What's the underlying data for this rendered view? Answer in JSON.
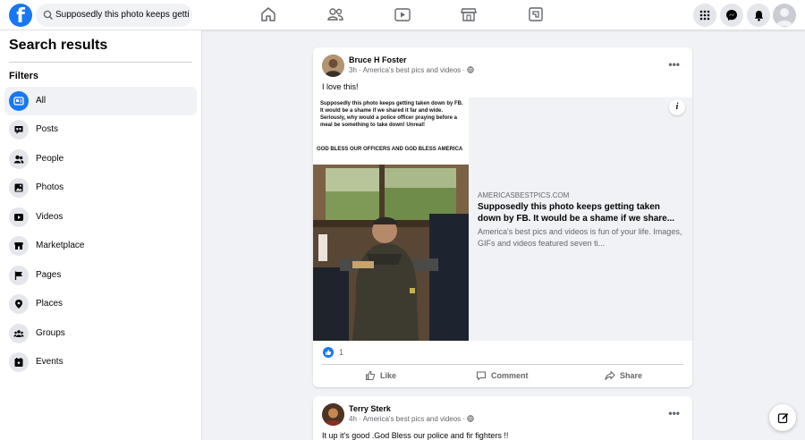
{
  "search": {
    "query": "Supposedly this photo keeps getti"
  },
  "sidebar": {
    "title": "Search results",
    "filters_heading": "Filters",
    "items": [
      {
        "label": "All",
        "icon": "all-results-icon",
        "active": true
      },
      {
        "label": "Posts",
        "icon": "posts-icon"
      },
      {
        "label": "People",
        "icon": "people-icon"
      },
      {
        "label": "Photos",
        "icon": "photos-icon"
      },
      {
        "label": "Videos",
        "icon": "videos-icon"
      },
      {
        "label": "Marketplace",
        "icon": "marketplace-icon"
      },
      {
        "label": "Pages",
        "icon": "pages-flag-icon"
      },
      {
        "label": "Places",
        "icon": "places-pin-icon"
      },
      {
        "label": "Groups",
        "icon": "groups-icon"
      },
      {
        "label": "Events",
        "icon": "events-icon"
      }
    ]
  },
  "posts": [
    {
      "author": "Bruce H Foster",
      "time": "3h",
      "source": "America's best pics and videos",
      "text": "I love this!",
      "link": {
        "meme_text": "Supposedly this photo keeps getting taken down by FB.  It would be a shame if we shared it far and wide.  Seriously, why would a police officer praying before a meal be something to take down! Unreal!",
        "meme_caption": "GOD BLESS OUR OFFICERS AND GOD BLESS AMERICA",
        "domain": "AMERICASBESTPICS.COM",
        "title": "Supposedly this photo keeps getting taken down by FB. It would be a shame if we share...",
        "description": "America's best pics and videos is fun of your life. Images, GIFs and videos featured seven ti..."
      },
      "reactions": "1",
      "actions": {
        "like": "Like",
        "comment": "Comment",
        "share": "Share"
      }
    },
    {
      "author": "Terry Sterk",
      "time": "4h",
      "source": "America's best pics and videos",
      "text": "It up it's good .God Bless our police and fir fighters !!"
    }
  ],
  "colors": {
    "brand": "#1877f2",
    "background": "#f0f2f5"
  }
}
